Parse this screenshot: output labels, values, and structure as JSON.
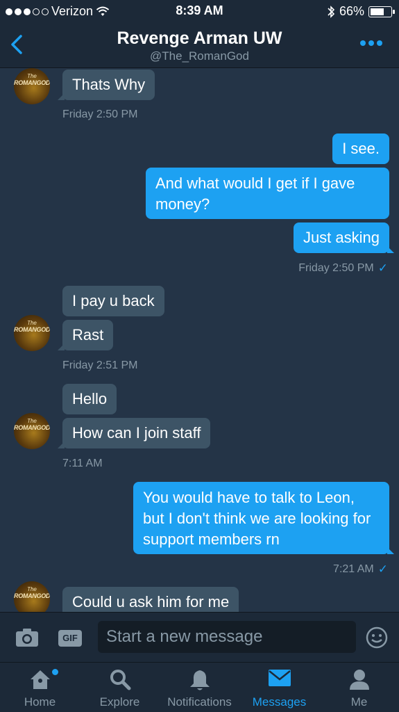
{
  "status_bar": {
    "carrier": "Verizon",
    "time": "8:39 AM",
    "battery": "66%"
  },
  "header": {
    "title": "Revenge Arman UW",
    "handle": "@The_RomanGod"
  },
  "avatar_text": {
    "line1": "The",
    "line2": "ROMANGOD"
  },
  "messages": [
    {
      "text": "Thats Why"
    },
    {
      "text": "I see."
    },
    {
      "text": "And what would I get if I gave money?"
    },
    {
      "text": "Just asking"
    },
    {
      "text": "I pay u back"
    },
    {
      "text": "Rast"
    },
    {
      "text": "Hello"
    },
    {
      "text": "How can I join staff"
    },
    {
      "text": "You would have to talk to Leon, but I don't think we are looking for support members rn"
    },
    {
      "text": "Could u ask him for me"
    }
  ],
  "timestamps": [
    "Friday 2:50 PM",
    "Friday 2:50 PM",
    "Friday 2:51 PM",
    "7:11 AM",
    "7:21 AM"
  ],
  "composer": {
    "placeholder": "Start a new message",
    "gif_label": "GIF"
  },
  "tabs": [
    {
      "label": "Home",
      "icon": "home-icon"
    },
    {
      "label": "Explore",
      "icon": "search-icon"
    },
    {
      "label": "Notifications",
      "icon": "bell-icon"
    },
    {
      "label": "Messages",
      "icon": "envelope-icon",
      "active": true
    },
    {
      "label": "Me",
      "icon": "person-icon"
    }
  ],
  "colors": {
    "accent": "#1da1f2",
    "background": "#243447",
    "incoming_bubble": "#3d5466"
  }
}
